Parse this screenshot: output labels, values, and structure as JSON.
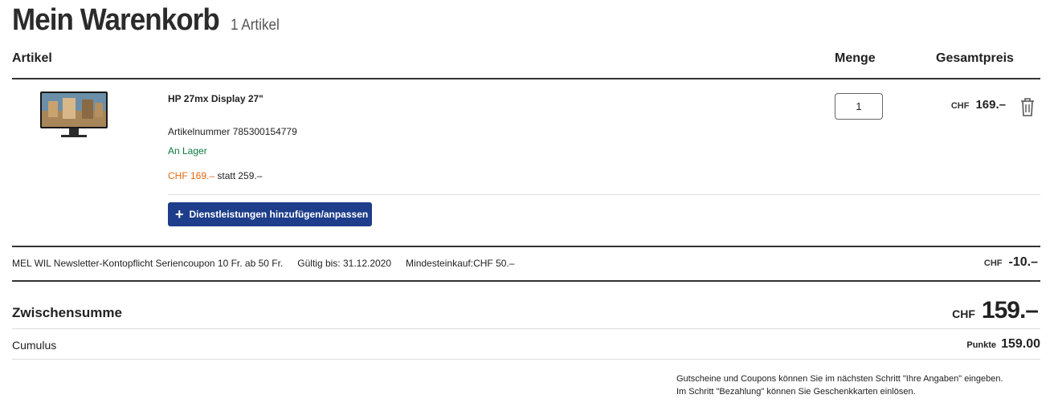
{
  "header": {
    "title": "Mein Warenkorb",
    "count": "1 Artikel"
  },
  "columns": {
    "artikel": "Artikel",
    "menge": "Menge",
    "gesamtpreis": "Gesamtpreis"
  },
  "item": {
    "name": "HP 27mx Display 27\"",
    "article_number": "Artikelnummer 785300154779",
    "stock": "An Lager",
    "sale_price": "CHF  169.–",
    "old_price": "statt 259.–",
    "service_button": "Dienstleistungen hinzufügen/anpassen",
    "quantity": "1",
    "total_currency": "CHF",
    "total_amount": "169.–",
    "image_icon": "monitor-image",
    "delete_icon": "trash-icon"
  },
  "coupon": {
    "name": "MEL WIL Newsletter-Kontopflicht Seriencoupon 10 Fr. ab 50 Fr.",
    "valid": "Gültig bis: 31.12.2020",
    "minimum": "Mindesteinkauf:CHF 50.–",
    "currency": "CHF",
    "amount": "-10.–"
  },
  "subtotal": {
    "label": "Zwischensumme",
    "currency": "CHF",
    "amount": "159.–"
  },
  "cumulus": {
    "label": "Cumulus",
    "unit": "Punkte",
    "amount": "159.00"
  },
  "note": {
    "line1": "Gutscheine und Coupons können Sie im nächsten Schritt \"Ihre Angaben\" eingeben.",
    "line2": "Im Schritt \"Bezahlung\" können Sie Geschenkkarten einlösen."
  },
  "colors": {
    "accent": "#1e3d8a",
    "sale": "#e8650d",
    "stock": "#0a7a3f"
  }
}
